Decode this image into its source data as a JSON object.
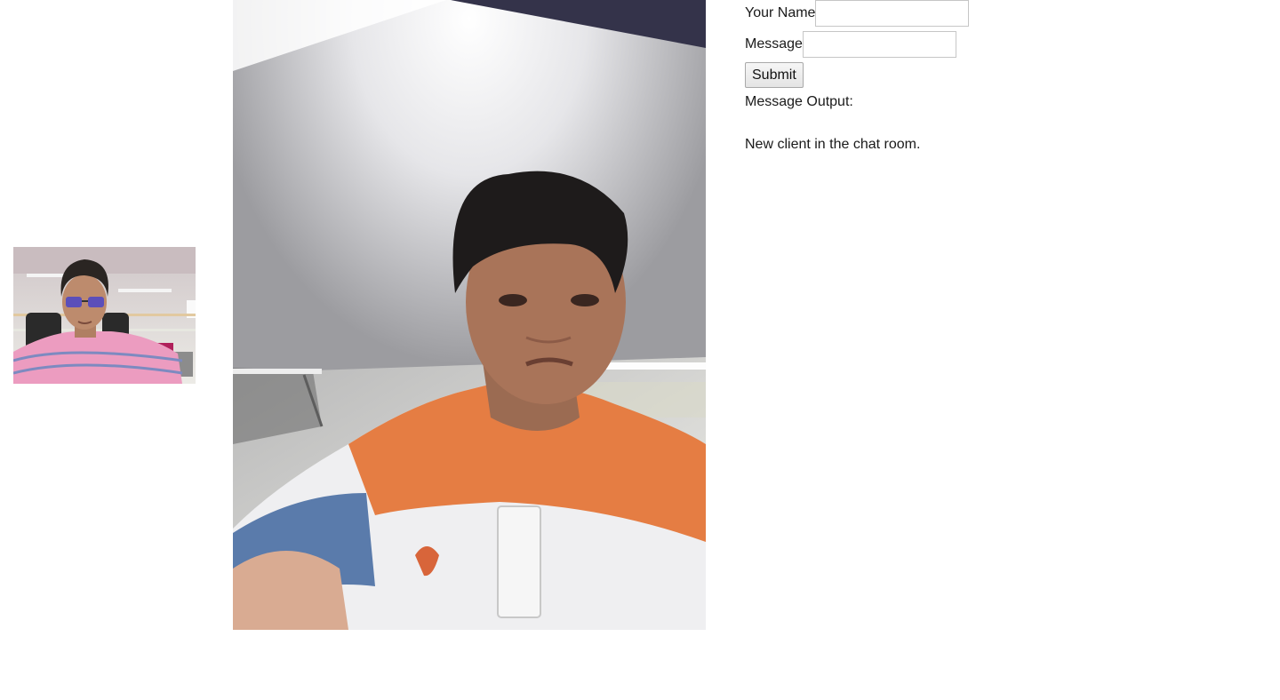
{
  "videos": {
    "local": {
      "name": "local-video"
    },
    "remote": {
      "name": "remote-video"
    }
  },
  "chat": {
    "name_label": "Your Name",
    "name_value": "",
    "message_label": "Message",
    "message_value": "",
    "submit_label": "Submit",
    "output_label": "Message Output:",
    "messages": [
      "New client in the chat room."
    ]
  }
}
